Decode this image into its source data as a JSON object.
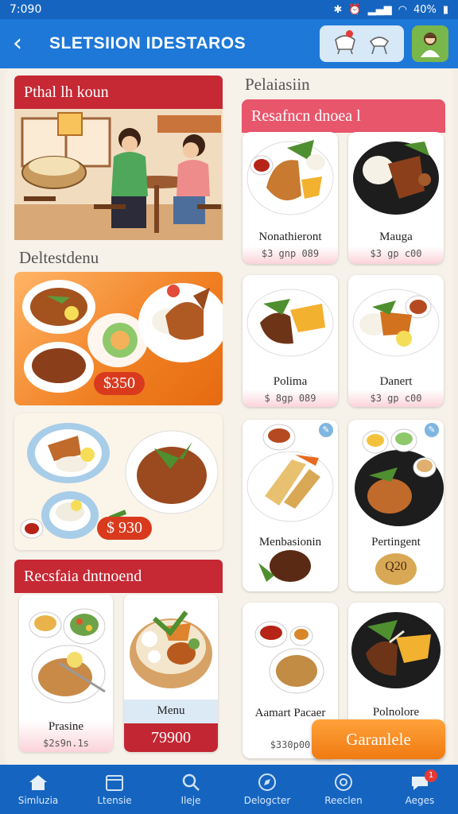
{
  "status_bar": {
    "time": "7:090",
    "battery": "40%"
  },
  "app_bar": {
    "title": "SLETSIION IDESTAROS"
  },
  "left_column": {
    "section1_title": "Pthal lh koun",
    "section2_label": "Deltestdenu",
    "orange_card_price": "$350",
    "cream_card_price": "$ 930",
    "section3_title": "Recsfaia dntnoend",
    "cards": [
      {
        "name": "Prasine",
        "price": "$2s9n.1s"
      },
      {
        "name": "Menu",
        "price": "79900"
      }
    ]
  },
  "right_column": {
    "label": "Pelaiasiin",
    "section_title": "Resafncn dnoea l",
    "dishes": [
      {
        "name": "Nonathieront",
        "price": "$3 gnp 089"
      },
      {
        "name": "Mauga",
        "price": "$3 gp c00"
      },
      {
        "name": "Polima",
        "price": "$ 8gp 089"
      },
      {
        "name": "Danert",
        "price": "$3 gp c00"
      },
      {
        "name": "Menbasionin",
        "price": ""
      },
      {
        "name": "Pertingent",
        "price": "Q20"
      },
      {
        "name": "Aamart Pacaer",
        "price": "$330p00"
      },
      {
        "name": "Polnolore",
        "price": ""
      }
    ]
  },
  "cta": {
    "label": "Garanlele"
  },
  "bottom_nav": [
    {
      "label": "Simluzia",
      "icon": "home-icon"
    },
    {
      "label": "Ltensie",
      "icon": "calendar-icon"
    },
    {
      "label": "Ileje",
      "icon": "search-icon"
    },
    {
      "label": "Delogcter",
      "icon": "compass-icon"
    },
    {
      "label": "Reeclen",
      "icon": "support-icon"
    },
    {
      "label": "Aeges",
      "icon": "chat-icon",
      "badge": "1"
    }
  ],
  "colors": {
    "primary": "#1e78d8",
    "section_red": "#c62834",
    "section_pink": "#e8566c",
    "accent_orange": "#f07a12"
  }
}
